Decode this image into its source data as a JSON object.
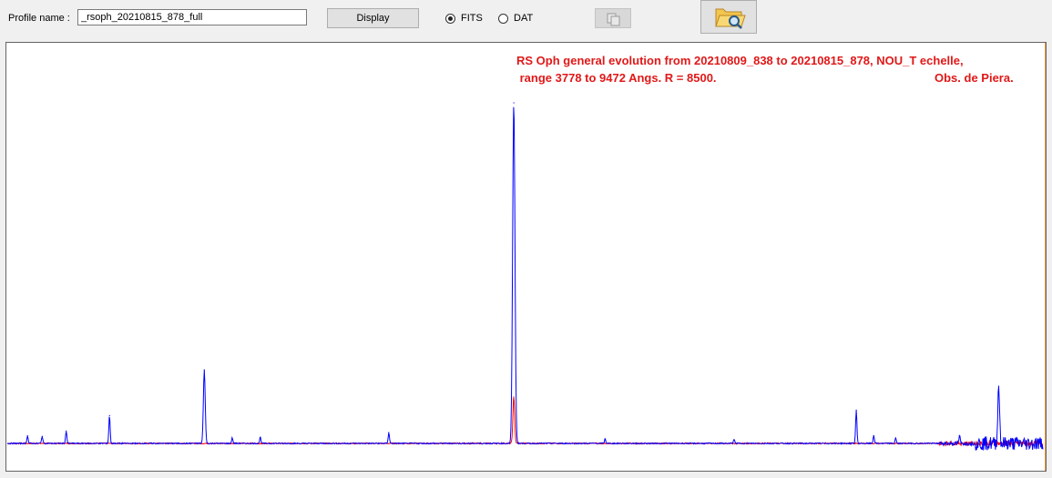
{
  "toolbar": {
    "profile_label": "Profile name :",
    "profile_value": "_rsoph_20210815_878_full",
    "display_label": "Display",
    "format_options": [
      {
        "label": "FITS",
        "selected": true
      },
      {
        "label": "DAT",
        "selected": false
      }
    ],
    "copy_icon": "copy-icon",
    "folder_icon": "folder-search-icon"
  },
  "plot": {
    "annotation_line1": "RS Oph general evolution from 20210809_838 to 20210815_878, NOU_T echelle,",
    "annotation_line2": " range 3778 to 9472 Angs. R = 8500.",
    "annotation_obs": "Obs. de Piera.",
    "colors": {
      "new_profile": "#0000ff",
      "old_profile": "#ff0000",
      "annotation": "#e01818"
    }
  },
  "chart_data": {
    "type": "line",
    "title": "RS Oph general evolution from 20210809_838 to 20210815_878, NOU_T echelle, range 3778 to 9472 Angs. R = 8500. Obs. de Piera.",
    "xlabel": "",
    "ylabel": "",
    "xlim": [
      3778,
      9472
    ],
    "grid": false,
    "series": [
      {
        "color": "#0000ff",
        "continuum": 1.0,
        "peaks": [
          {
            "x": 3889,
            "y": 2.0
          },
          {
            "x": 3970,
            "y": 1.9
          },
          {
            "x": 4102,
            "y": 2.6
          },
          {
            "x": 4340,
            "y": 4.6
          },
          {
            "x": 4861,
            "y": 10.5
          },
          {
            "x": 5015,
            "y": 1.7
          },
          {
            "x": 5169,
            "y": 1.8
          },
          {
            "x": 5876,
            "y": 2.4
          },
          {
            "x": 6563,
            "y": 45.0
          },
          {
            "x": 7065,
            "y": 1.6
          },
          {
            "x": 7774,
            "y": 1.5
          },
          {
            "x": 8446,
            "y": 5.3
          },
          {
            "x": 8542,
            "y": 2.0
          },
          {
            "x": 8662,
            "y": 1.7
          },
          {
            "x": 9014,
            "y": 1.9
          },
          {
            "x": 9229,
            "y": 8.4
          }
        ]
      },
      {
        "color": "#ff0000",
        "continuum": 1.0,
        "peaks": [
          {
            "x": 6563,
            "y": 7.0
          }
        ]
      }
    ]
  }
}
